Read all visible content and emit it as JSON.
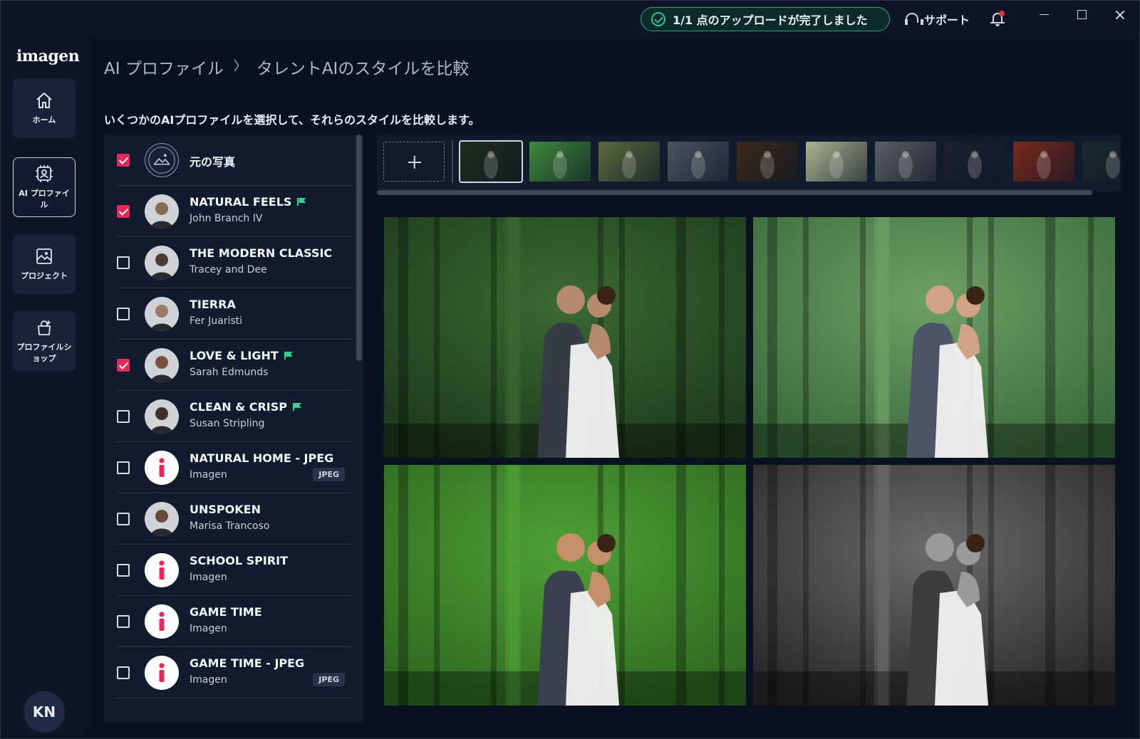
{
  "titlebar": {
    "upload_status": "1/1 点のアップロードが完了しました",
    "support_label": "サポート",
    "has_notification": true
  },
  "app": {
    "logo": "imagen"
  },
  "sidebar": {
    "items": [
      {
        "label": "ホーム",
        "icon": "home-icon",
        "active": false
      },
      {
        "label": "AI プロファイル",
        "icon": "ai-profile-icon",
        "active": true
      },
      {
        "label": "プロジェクト",
        "icon": "projects-icon",
        "active": false
      },
      {
        "label": "プロファイルショップ",
        "icon": "profile-shop-icon",
        "active": false
      }
    ],
    "user_initials": "KN"
  },
  "main": {
    "breadcrumb": {
      "parent": "AI プロファイル",
      "separator": "〉",
      "current": "タレントAIのスタイルを比較"
    },
    "instruction": "いくつかのAIプロファイルを選択して、それらのスタイルを比較します。"
  },
  "profiles": [
    {
      "name": "元の写真",
      "author": "",
      "checked": true,
      "avatar": "original-photo",
      "flag": false,
      "badge": ""
    },
    {
      "name": "NATURAL FEELS",
      "author": "John Branch IV",
      "checked": true,
      "avatar": "person",
      "flag": true,
      "badge": ""
    },
    {
      "name": "THE MODERN CLASSIC",
      "author": "Tracey and Dee",
      "checked": false,
      "avatar": "person",
      "flag": false,
      "badge": ""
    },
    {
      "name": "TIERRA",
      "author": "Fer Juaristi",
      "checked": false,
      "avatar": "person",
      "flag": false,
      "badge": ""
    },
    {
      "name": "LOVE & LIGHT",
      "author": "Sarah Edmunds",
      "checked": true,
      "avatar": "person",
      "flag": true,
      "badge": ""
    },
    {
      "name": "CLEAN & CRISP",
      "author": "Susan Stripling",
      "checked": false,
      "avatar": "person",
      "flag": true,
      "badge": ""
    },
    {
      "name": "NATURAL HOME - JPEG",
      "author": "Imagen",
      "checked": false,
      "avatar": "imagen",
      "flag": false,
      "badge": "JPEG"
    },
    {
      "name": "UNSPOKEN",
      "author": "Marisa Trancoso",
      "checked": false,
      "avatar": "person",
      "flag": false,
      "badge": ""
    },
    {
      "name": "SCHOOL SPIRIT",
      "author": "Imagen",
      "checked": false,
      "avatar": "imagen",
      "flag": false,
      "badge": ""
    },
    {
      "name": "GAME TIME",
      "author": "Imagen",
      "checked": false,
      "avatar": "imagen",
      "flag": false,
      "badge": ""
    },
    {
      "name": "GAME TIME - JPEG",
      "author": "Imagen",
      "checked": false,
      "avatar": "imagen",
      "flag": false,
      "badge": "JPEG"
    }
  ],
  "thumbnails": {
    "count": 11,
    "selected_index": 0,
    "tones": [
      "#1d2f1c",
      "#3f8a3a",
      "#5b6a3e",
      "#4a5560",
      "#3b2a1a",
      "#a9b38f",
      "#5a5e66",
      "#1c2330",
      "#7a2a1e",
      "#1b2a30",
      "#2a2a2a"
    ]
  },
  "comparison": [
    {
      "style": "original",
      "forest": "#1e3b1c",
      "light": "#3c6a34",
      "suit": "#353b47",
      "skin": "#b58a6c"
    },
    {
      "style": "natural-feels",
      "forest": "#3a6b3c",
      "light": "#6ea066",
      "suit": "#4b5566",
      "skin": "#d1a386"
    },
    {
      "style": "love-light",
      "forest": "#2f6a22",
      "light": "#4fa036",
      "suit": "#3a404e",
      "skin": "#c58f6c"
    },
    {
      "style": "black-white",
      "forest": "#2a2a2a",
      "light": "#6c6c6c",
      "suit": "#3c3c3c",
      "skin": "#9a9a9a"
    }
  ]
}
